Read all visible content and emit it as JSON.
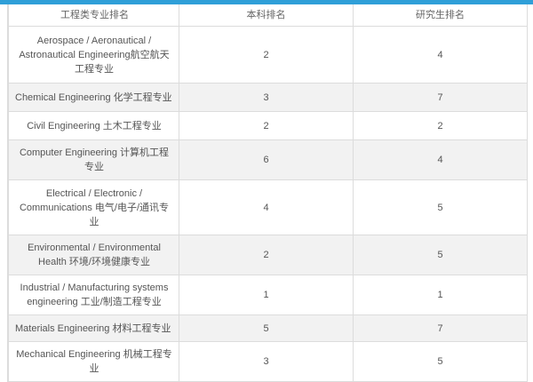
{
  "header": {
    "col_name": "工程类专业排名",
    "col_undergrad": "本科排名",
    "col_grad": "研究生排名"
  },
  "rows": [
    {
      "name": "Aerospace / Aeronautical / Astronautical Engineering航空航天工程专业",
      "undergrad": "2",
      "grad": "4"
    },
    {
      "name": "Chemical Engineering 化学工程专业",
      "undergrad": "3",
      "grad": "7"
    },
    {
      "name": "Civil Engineering 土木工程专业",
      "undergrad": "2",
      "grad": "2"
    },
    {
      "name": "Computer Engineering 计算机工程专业",
      "undergrad": "6",
      "grad": "4"
    },
    {
      "name": "Electrical / Electronic / Communications 电气/电子/通讯专业",
      "undergrad": "4",
      "grad": "5"
    },
    {
      "name": "Environmental / Environmental Health 环境/环境健康专业",
      "undergrad": "2",
      "grad": "5"
    },
    {
      "name": "Industrial / Manufacturing systems engineering 工业/制造工程专业",
      "undergrad": "1",
      "grad": "1"
    },
    {
      "name": "Materials Engineering 材料工程专业",
      "undergrad": "5",
      "grad": "7"
    },
    {
      "name": "Mechanical Engineering 机械工程专业",
      "undergrad": "3",
      "grad": "5"
    }
  ],
  "colors": {
    "accent_strip": "#2f9fd8",
    "row_stripe": "#f2f2f2",
    "border": "#dcdcdc"
  }
}
